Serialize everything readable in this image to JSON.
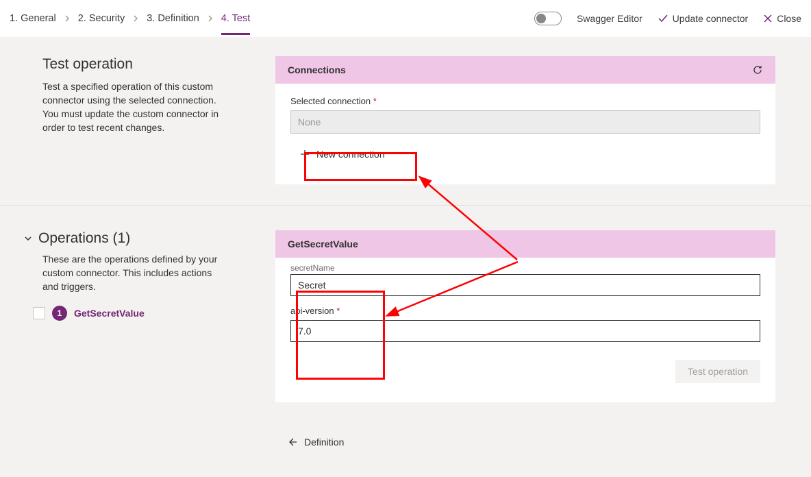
{
  "breadcrumb": {
    "step1": "1. General",
    "step2": "2. Security",
    "step3": "3. Definition",
    "step4": "4. Test"
  },
  "topActions": {
    "swagger": "Swagger Editor",
    "update": "Update connector",
    "close": "Close"
  },
  "testOp": {
    "title": "Test operation",
    "desc": "Test a specified operation of this custom connector using the selected connection. You must update the custom connector in order to test recent changes."
  },
  "connections": {
    "header": "Connections",
    "selLabel": "Selected connection",
    "selValue": "None",
    "newConn": "New connection"
  },
  "operations": {
    "heading": "Operations (1)",
    "desc": "These are the operations defined by your custom connector. This includes actions and triggers.",
    "badge": "1",
    "name": "GetSecretValue"
  },
  "opPanel": {
    "header": "GetSecretValue",
    "secretNameLabel": "secretName",
    "secretNameValue": "Secret",
    "apiVersionLabel": "api-version",
    "apiVersionValue": "7.0",
    "testBtn": "Test operation"
  },
  "backLink": "Definition"
}
